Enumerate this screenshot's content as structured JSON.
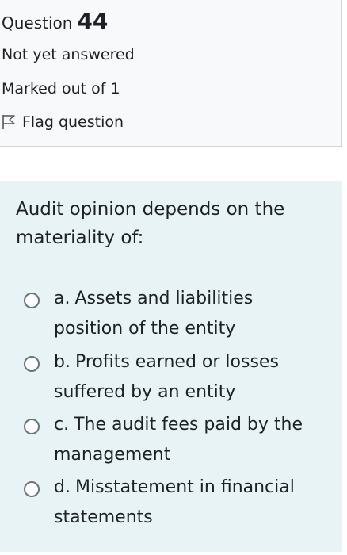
{
  "question_info": {
    "question_label": "Question",
    "question_number": "44",
    "state": "Not yet answered",
    "grade": "Marked out of 1",
    "flag_label": "Flag question"
  },
  "question": {
    "text": "Audit opinion depends on the materiality of:",
    "options": [
      {
        "letter": "a.",
        "text": "Assets and liabilities position of the entity"
      },
      {
        "letter": "b.",
        "text": "Profits earned or losses suffered by an entity"
      },
      {
        "letter": "c.",
        "text": "The audit fees paid by the management"
      },
      {
        "letter": "d.",
        "text": "Misstatement in financial statements"
      }
    ]
  },
  "colors": {
    "info_background": "#f8f9fa",
    "question_background": "#e7f3f5",
    "text": "#1d2125",
    "radio_border": "#6a737b"
  },
  "icons": {
    "flag": "flag-outline-icon",
    "radio": "radio-unchecked-icon"
  }
}
